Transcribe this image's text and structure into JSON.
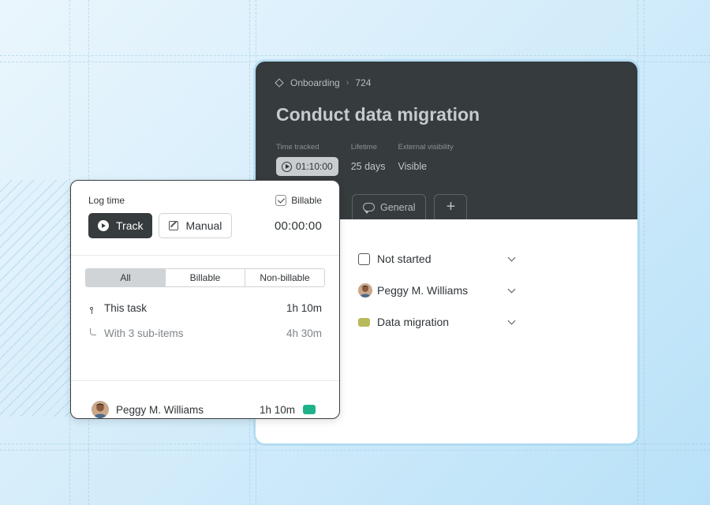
{
  "task": {
    "breadcrumb": {
      "project": "Onboarding",
      "id": "724"
    },
    "title": "Conduct data migration",
    "meta": [
      {
        "label": "Time tracked",
        "value": "01:10:00"
      },
      {
        "label": "Lifetime",
        "value": "25 days"
      },
      {
        "label": "External visibility",
        "value": "Visible"
      }
    ],
    "tabs": {
      "general": "General",
      "add": "+"
    },
    "fields": {
      "status": "Not started",
      "assignee": "Peggy M. Williams",
      "tag": "Data migration"
    }
  },
  "log_time": {
    "label": "Log time",
    "billable_label": "Billable",
    "billable_checked": true,
    "track_label": "Track",
    "manual_label": "Manual",
    "timer": "00:00:00",
    "filters": [
      "All",
      "Billable",
      "Non-billable"
    ],
    "selected_filter": "All",
    "this_task": {
      "label": "This task",
      "value": "1h 10m"
    },
    "sub_items": {
      "label": "With 3 sub-items",
      "value": "4h 30m"
    },
    "user": {
      "name": "Peggy M. Williams",
      "time": "1h 10m"
    }
  },
  "colors": {
    "header_bg": "#363b3e",
    "tag_olive": "#b8b95a",
    "user_tag_green": "#1fb28a"
  },
  "icons": [
    "diamond-icon",
    "chevron-right-icon",
    "play-circle-icon",
    "comment-icon",
    "plus-icon",
    "checkbox-icon",
    "chevron-down-icon",
    "play-icon",
    "edit-icon",
    "key-icon",
    "branch-icon",
    "checkmark-icon"
  ]
}
